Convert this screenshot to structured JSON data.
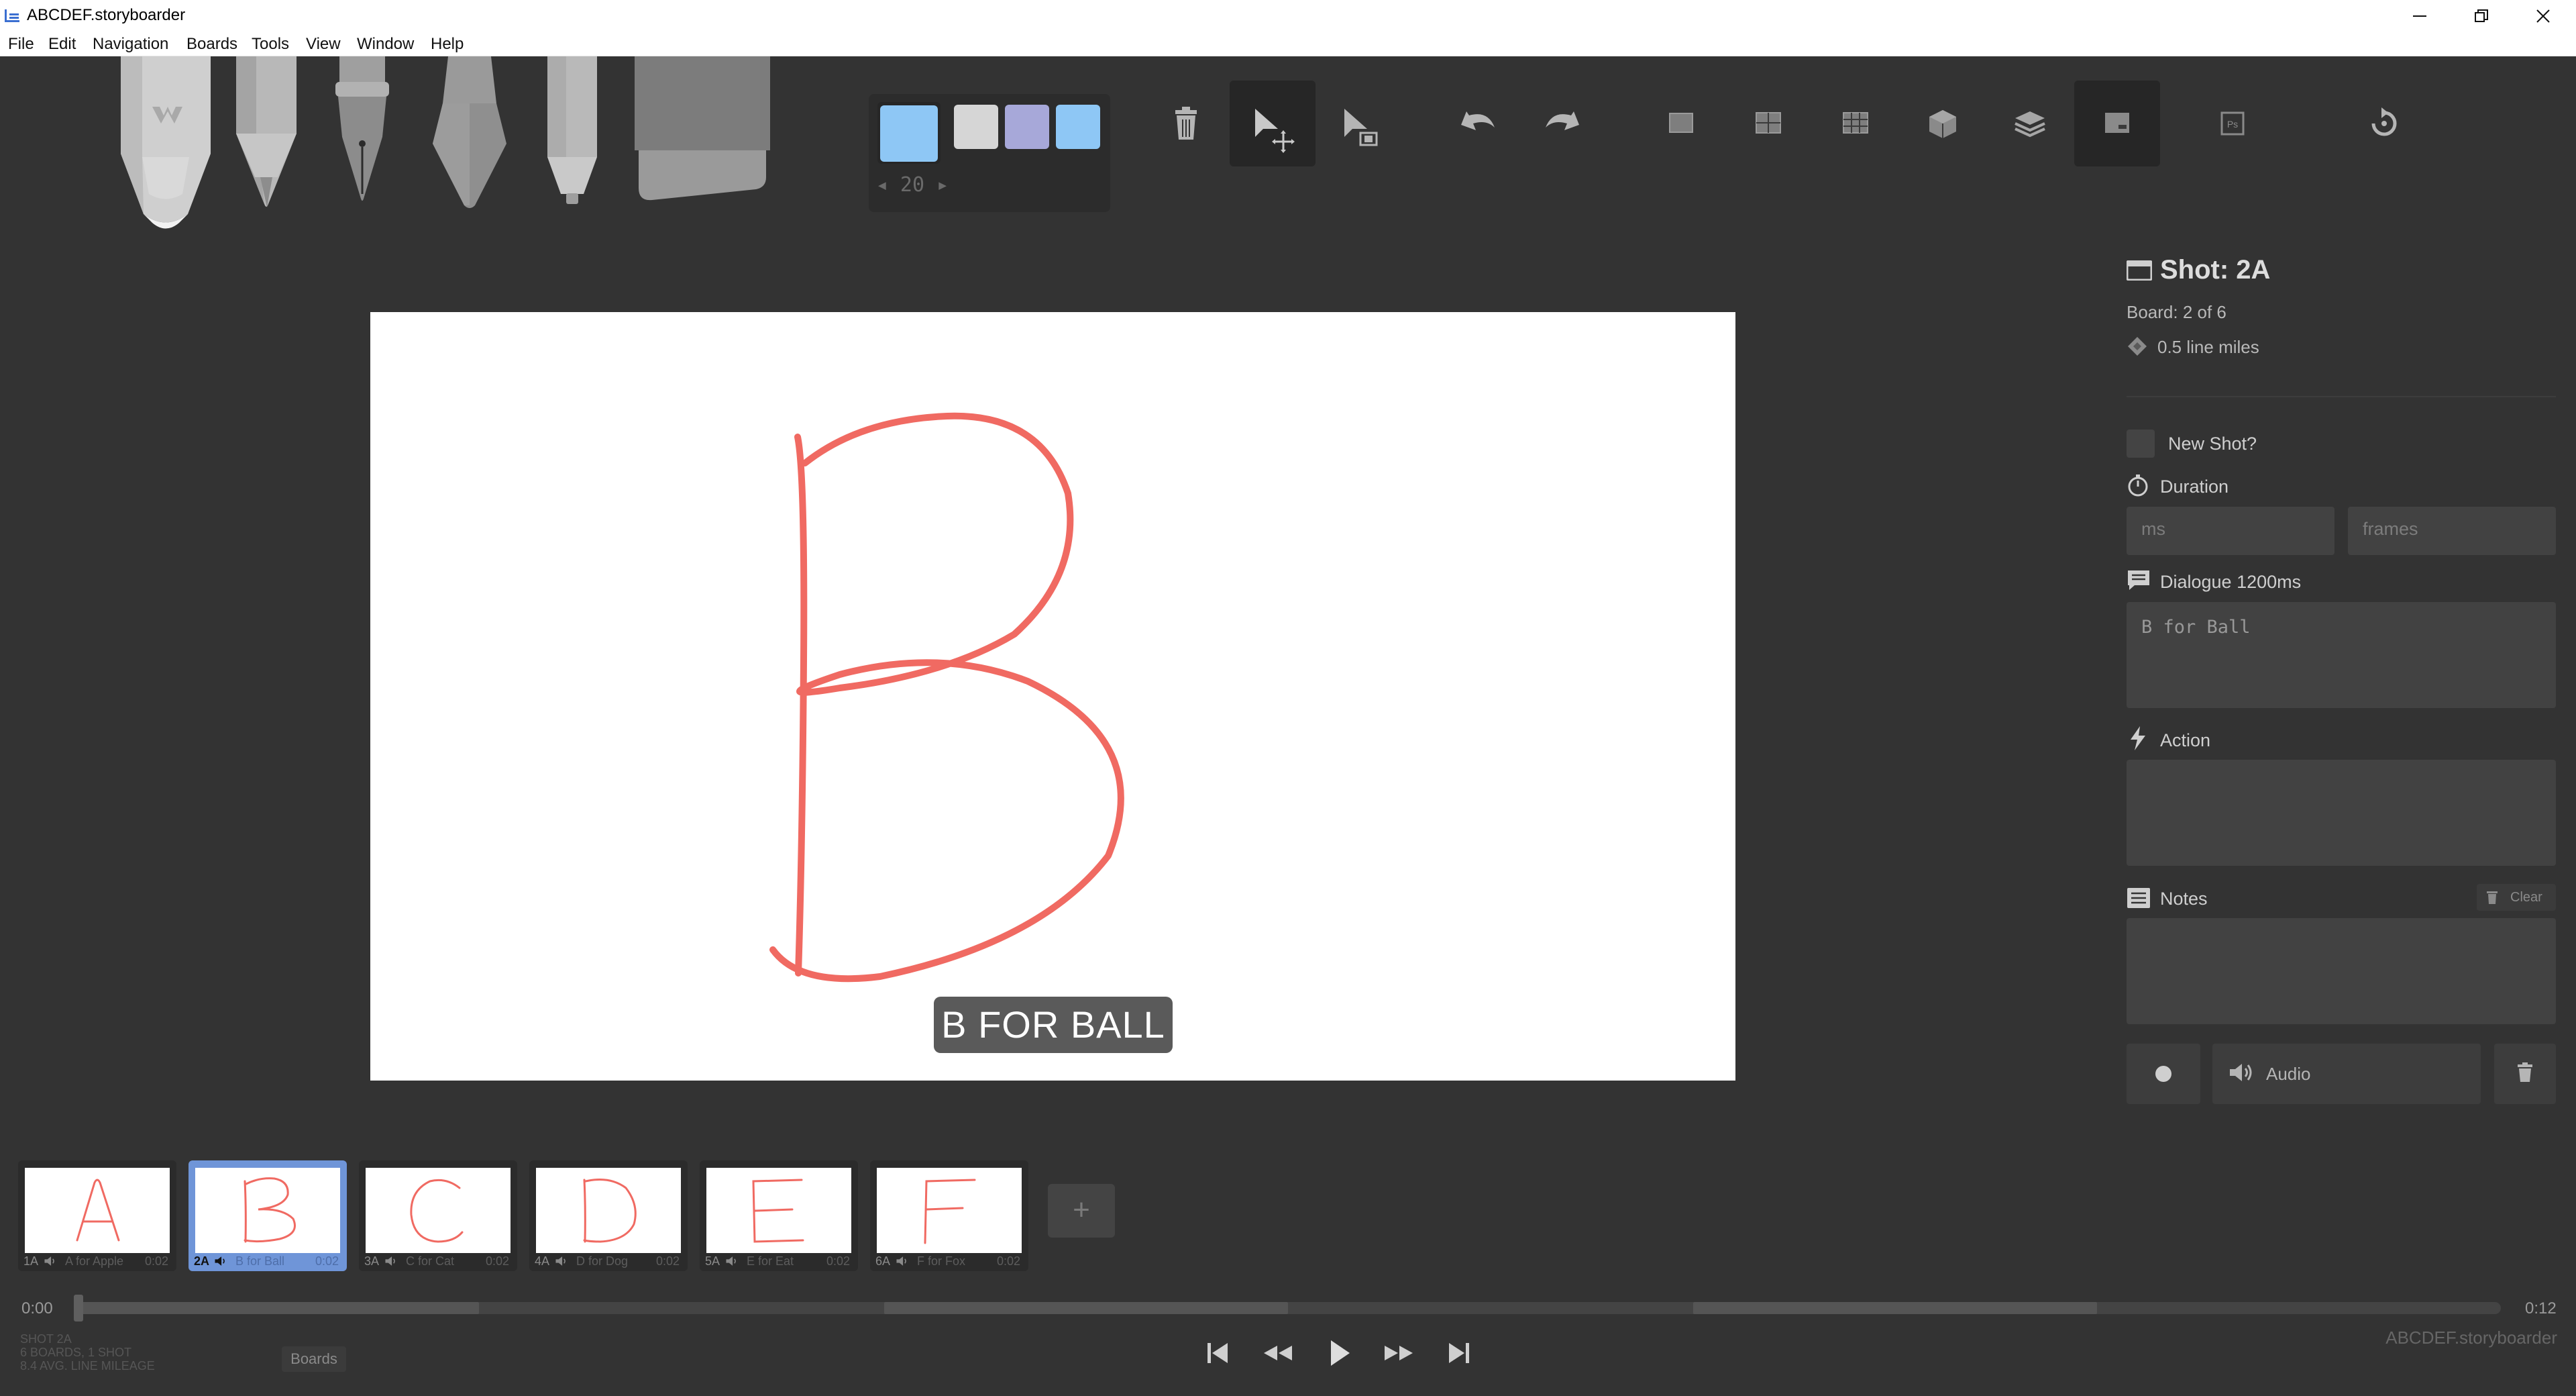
{
  "window": {
    "title": "ABCDEF.storyboarder",
    "controls": [
      "minimize",
      "restore",
      "close"
    ]
  },
  "menu": {
    "items": [
      "File",
      "Edit",
      "Navigation",
      "Boards",
      "Tools",
      "View",
      "Window",
      "Help"
    ]
  },
  "toolbar": {
    "tools": [
      "light-pencil-icon",
      "pencil-icon",
      "pen-icon",
      "brush-icon",
      "note-pen-icon",
      "eraser-icon"
    ],
    "palette": {
      "current": "#8ec7f5",
      "colors": [
        "#d6d6d6",
        "#a7a8d9",
        "#8ec7f5"
      ]
    },
    "brush_size": "◂ 20 ▸",
    "buttons": [
      "trash-icon",
      "move-icon",
      "scale-icon",
      "undo-icon",
      "redo-icon",
      "grid-icon",
      "center-icon",
      "thirds-icon",
      "perspective-icon",
      "onion-skin-icon",
      "captions-icon",
      "photoshop-icon",
      "refresh-icon"
    ]
  },
  "canvas": {
    "drawing": "letter B",
    "stroke_color": "#f06a62",
    "caption": "B FOR BALL"
  },
  "panel": {
    "shot_title": "Shot: 2A",
    "board_position": "Board: 2 of 6",
    "line_miles": "0.5 line miles",
    "new_shot_label": "New Shot?",
    "duration_label": "Duration",
    "duration_ms_placeholder": "ms",
    "duration_frames_placeholder": "frames",
    "dialogue_label": "Dialogue 1200ms",
    "dialogue_value": "B for Ball",
    "action_label": "Action",
    "action_value": "",
    "notes_label": "Notes",
    "notes_clear": "Clear",
    "notes_value": "",
    "audio_label": "Audio"
  },
  "boards": [
    {
      "number": "1A",
      "letter": "A",
      "caption": "A for Apple",
      "duration": "0:02",
      "active": false
    },
    {
      "number": "2A",
      "letter": "B",
      "caption": "B for Ball",
      "duration": "0:02",
      "active": true
    },
    {
      "number": "3A",
      "letter": "C",
      "caption": "C for Cat",
      "duration": "0:02",
      "active": false
    },
    {
      "number": "4A",
      "letter": "D",
      "caption": "D for Dog",
      "duration": "0:02",
      "active": false
    },
    {
      "number": "5A",
      "letter": "E",
      "caption": "E for Eat",
      "duration": "0:02",
      "active": false
    },
    {
      "number": "6A",
      "letter": "F",
      "caption": "F for Fox",
      "duration": "0:02",
      "active": false
    }
  ],
  "add_board_label": "+",
  "timeline": {
    "start": "0:00",
    "end": "0:12"
  },
  "status": {
    "shot": "SHOT 2A",
    "summary": "6 BOARDS, 1 SHOT",
    "mileage": "8.4 AVG. LINE MILEAGE",
    "boards_button": "Boards",
    "app_name": "ABCDEF.storyboarder"
  }
}
